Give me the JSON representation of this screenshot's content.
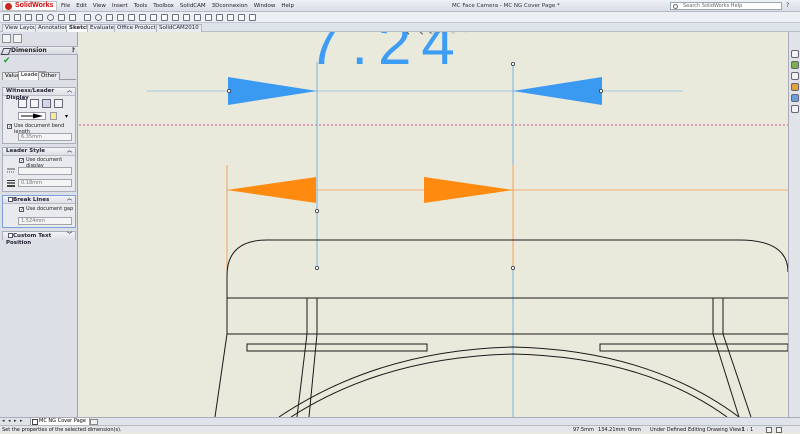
{
  "app": {
    "logo": "SolidWorks",
    "window_title": "MC Face Camera - MC NG Cover Page *",
    "search_placeholder": "Search SolidWorks Help"
  },
  "menu": [
    "File",
    "Edit",
    "View",
    "Insert",
    "Tools",
    "Toolbox",
    "SolidCAM",
    "3Dconnexion",
    "Window",
    "Help"
  ],
  "tabs": [
    "View Layout",
    "Annotation",
    "Sketch",
    "Evaluate",
    "Office Products",
    "SolidCAM2010"
  ],
  "active_tab": "Sketch",
  "property_manager": {
    "title": "Dimension",
    "help": "?",
    "subtabs": [
      "Value",
      "Leaders",
      "Other"
    ],
    "active_subtab": "Leaders",
    "witness_group": {
      "title": "Witness/Leader Display",
      "use_bend_length": "Use document bend length",
      "bend_length": "6.35mm"
    },
    "leader_style": {
      "title": "Leader Style",
      "use_display": "Use document display",
      "thickness": "0.18mm"
    },
    "break_lines": {
      "title": "Break Lines",
      "use_gap": "Use document gap",
      "gap": "1.524mm"
    },
    "custom_text": {
      "title": "Custom Text Position"
    }
  },
  "drawing": {
    "dimension_text": "7.24"
  },
  "sheet_tab": "MC NG Cover Page",
  "status": {
    "hint": "Set the properties of the selected dimension(s).",
    "x": "97.5mm",
    "y": "134.21mm",
    "z": "0mm",
    "state": "Under Defined",
    "mode": "Editing Drawing View1",
    "scale": "1 : 1"
  }
}
